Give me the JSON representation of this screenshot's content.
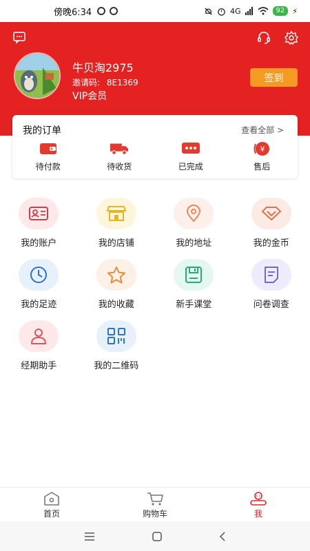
{
  "status_bar": {
    "time": "傍晚6:34",
    "network": "4G",
    "battery": "92"
  },
  "header": {
    "username": "牛贝淘2975",
    "invite_label": "邀请码:",
    "invite_code": "8E1369",
    "member_level": "VIP会员",
    "signin_label": "签到"
  },
  "orders": {
    "title": "我的订单",
    "view_all": "查看全部 >",
    "items": [
      {
        "label": "待付款",
        "icon": "wallet-icon"
      },
      {
        "label": "待收货",
        "icon": "delivery-truck-icon"
      },
      {
        "label": "已完成",
        "icon": "chat-dots-icon"
      },
      {
        "label": "售后",
        "icon": "yen-coin-icon"
      }
    ]
  },
  "menu": [
    {
      "label": "我的账户",
      "icon": "id-card-icon",
      "tint": "#fde9ea",
      "color": "#d63a4a"
    },
    {
      "label": "我的店铺",
      "icon": "store-icon",
      "tint": "#fdf5dc",
      "color": "#e7b51c"
    },
    {
      "label": "我的地址",
      "icon": "location-pin-icon",
      "tint": "#fdf0ea",
      "color": "#e8865a"
    },
    {
      "label": "我的金币",
      "icon": "diamond-icon",
      "tint": "#fcebe4",
      "color": "#e0724a"
    },
    {
      "label": "我的足迹",
      "icon": "clock-icon",
      "tint": "#e6f1fc",
      "color": "#2a73c8"
    },
    {
      "label": "我的收藏",
      "icon": "star-icon",
      "tint": "#fdf0e6",
      "color": "#e98a3a"
    },
    {
      "label": "新手课堂",
      "icon": "save-disk-icon",
      "tint": "#e5f7f1",
      "color": "#27a87f"
    },
    {
      "label": "问卷调查",
      "icon": "survey-icon",
      "tint": "#eeebfb",
      "color": "#7a64d8"
    },
    {
      "label": "经期助手",
      "icon": "person-icon",
      "tint": "#fde9ea",
      "color": "#d9555c"
    },
    {
      "label": "我的二维码",
      "icon": "qr-code-icon",
      "tint": "#e6f1fc",
      "color": "#2a73c8"
    }
  ],
  "bottom_nav": [
    {
      "label": "首页",
      "icon": "home-icon",
      "active": false
    },
    {
      "label": "购物车",
      "icon": "cart-icon",
      "active": false
    },
    {
      "label": "我",
      "icon": "profile-icon",
      "active": true
    }
  ],
  "colors": {
    "header_red": "#e32221",
    "signin_orange": "#f59b23",
    "active_red": "#d9252b"
  }
}
